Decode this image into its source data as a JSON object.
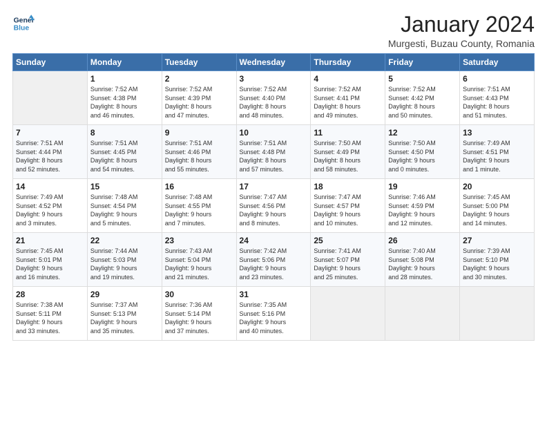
{
  "header": {
    "logo_line1": "General",
    "logo_line2": "Blue",
    "month_title": "January 2024",
    "location": "Murgesti, Buzau County, Romania"
  },
  "days_of_week": [
    "Sunday",
    "Monday",
    "Tuesday",
    "Wednesday",
    "Thursday",
    "Friday",
    "Saturday"
  ],
  "weeks": [
    [
      {
        "day": "",
        "info": ""
      },
      {
        "day": "1",
        "info": "Sunrise: 7:52 AM\nSunset: 4:38 PM\nDaylight: 8 hours\nand 46 minutes."
      },
      {
        "day": "2",
        "info": "Sunrise: 7:52 AM\nSunset: 4:39 PM\nDaylight: 8 hours\nand 47 minutes."
      },
      {
        "day": "3",
        "info": "Sunrise: 7:52 AM\nSunset: 4:40 PM\nDaylight: 8 hours\nand 48 minutes."
      },
      {
        "day": "4",
        "info": "Sunrise: 7:52 AM\nSunset: 4:41 PM\nDaylight: 8 hours\nand 49 minutes."
      },
      {
        "day": "5",
        "info": "Sunrise: 7:52 AM\nSunset: 4:42 PM\nDaylight: 8 hours\nand 50 minutes."
      },
      {
        "day": "6",
        "info": "Sunrise: 7:51 AM\nSunset: 4:43 PM\nDaylight: 8 hours\nand 51 minutes."
      }
    ],
    [
      {
        "day": "7",
        "info": "Sunrise: 7:51 AM\nSunset: 4:44 PM\nDaylight: 8 hours\nand 52 minutes."
      },
      {
        "day": "8",
        "info": "Sunrise: 7:51 AM\nSunset: 4:45 PM\nDaylight: 8 hours\nand 54 minutes."
      },
      {
        "day": "9",
        "info": "Sunrise: 7:51 AM\nSunset: 4:46 PM\nDaylight: 8 hours\nand 55 minutes."
      },
      {
        "day": "10",
        "info": "Sunrise: 7:51 AM\nSunset: 4:48 PM\nDaylight: 8 hours\nand 57 minutes."
      },
      {
        "day": "11",
        "info": "Sunrise: 7:50 AM\nSunset: 4:49 PM\nDaylight: 8 hours\nand 58 minutes."
      },
      {
        "day": "12",
        "info": "Sunrise: 7:50 AM\nSunset: 4:50 PM\nDaylight: 9 hours\nand 0 minutes."
      },
      {
        "day": "13",
        "info": "Sunrise: 7:49 AM\nSunset: 4:51 PM\nDaylight: 9 hours\nand 1 minute."
      }
    ],
    [
      {
        "day": "14",
        "info": "Sunrise: 7:49 AM\nSunset: 4:52 PM\nDaylight: 9 hours\nand 3 minutes."
      },
      {
        "day": "15",
        "info": "Sunrise: 7:48 AM\nSunset: 4:54 PM\nDaylight: 9 hours\nand 5 minutes."
      },
      {
        "day": "16",
        "info": "Sunrise: 7:48 AM\nSunset: 4:55 PM\nDaylight: 9 hours\nand 7 minutes."
      },
      {
        "day": "17",
        "info": "Sunrise: 7:47 AM\nSunset: 4:56 PM\nDaylight: 9 hours\nand 8 minutes."
      },
      {
        "day": "18",
        "info": "Sunrise: 7:47 AM\nSunset: 4:57 PM\nDaylight: 9 hours\nand 10 minutes."
      },
      {
        "day": "19",
        "info": "Sunrise: 7:46 AM\nSunset: 4:59 PM\nDaylight: 9 hours\nand 12 minutes."
      },
      {
        "day": "20",
        "info": "Sunrise: 7:45 AM\nSunset: 5:00 PM\nDaylight: 9 hours\nand 14 minutes."
      }
    ],
    [
      {
        "day": "21",
        "info": "Sunrise: 7:45 AM\nSunset: 5:01 PM\nDaylight: 9 hours\nand 16 minutes."
      },
      {
        "day": "22",
        "info": "Sunrise: 7:44 AM\nSunset: 5:03 PM\nDaylight: 9 hours\nand 19 minutes."
      },
      {
        "day": "23",
        "info": "Sunrise: 7:43 AM\nSunset: 5:04 PM\nDaylight: 9 hours\nand 21 minutes."
      },
      {
        "day": "24",
        "info": "Sunrise: 7:42 AM\nSunset: 5:06 PM\nDaylight: 9 hours\nand 23 minutes."
      },
      {
        "day": "25",
        "info": "Sunrise: 7:41 AM\nSunset: 5:07 PM\nDaylight: 9 hours\nand 25 minutes."
      },
      {
        "day": "26",
        "info": "Sunrise: 7:40 AM\nSunset: 5:08 PM\nDaylight: 9 hours\nand 28 minutes."
      },
      {
        "day": "27",
        "info": "Sunrise: 7:39 AM\nSunset: 5:10 PM\nDaylight: 9 hours\nand 30 minutes."
      }
    ],
    [
      {
        "day": "28",
        "info": "Sunrise: 7:38 AM\nSunset: 5:11 PM\nDaylight: 9 hours\nand 33 minutes."
      },
      {
        "day": "29",
        "info": "Sunrise: 7:37 AM\nSunset: 5:13 PM\nDaylight: 9 hours\nand 35 minutes."
      },
      {
        "day": "30",
        "info": "Sunrise: 7:36 AM\nSunset: 5:14 PM\nDaylight: 9 hours\nand 37 minutes."
      },
      {
        "day": "31",
        "info": "Sunrise: 7:35 AM\nSunset: 5:16 PM\nDaylight: 9 hours\nand 40 minutes."
      },
      {
        "day": "",
        "info": ""
      },
      {
        "day": "",
        "info": ""
      },
      {
        "day": "",
        "info": ""
      }
    ]
  ]
}
